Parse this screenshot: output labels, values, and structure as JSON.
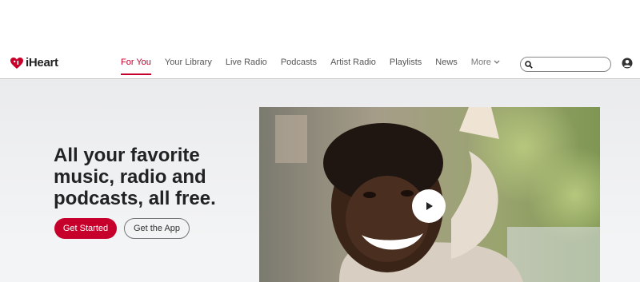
{
  "brand": {
    "name": "iHeart",
    "accent": "#c6002b"
  },
  "nav": {
    "items": [
      {
        "label": "For You",
        "active": true
      },
      {
        "label": "Your Library"
      },
      {
        "label": "Live Radio"
      },
      {
        "label": "Podcasts"
      },
      {
        "label": "Artist Radio"
      },
      {
        "label": "Playlists"
      },
      {
        "label": "News"
      },
      {
        "label": "More"
      }
    ]
  },
  "search": {
    "value": "",
    "icon": "search-icon"
  },
  "account": {
    "icon": "user-account-icon"
  },
  "hero": {
    "headline": "All your favorite music, radio and podcasts, all free.",
    "primary_button": "Get Started",
    "secondary_button": "Get the App",
    "video": {
      "icon": "play-icon"
    }
  }
}
